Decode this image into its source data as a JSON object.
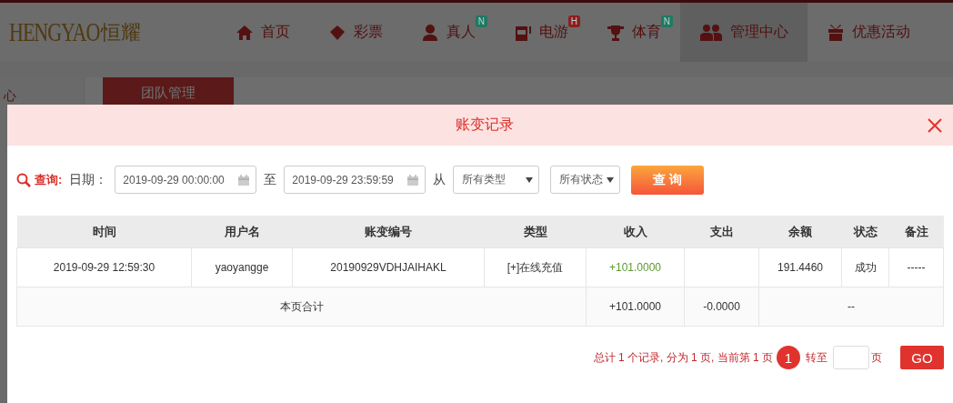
{
  "header": {
    "logo_latin": "HENGYAO",
    "logo_cjk": "恒耀",
    "nav": [
      {
        "label": "首页",
        "selected": false
      },
      {
        "label": "彩票",
        "selected": false
      },
      {
        "label": "真人",
        "badge": "N",
        "color": "#1c7a63",
        "selected": false
      },
      {
        "label": "电游",
        "badge": "H",
        "color": "#8c1e1e",
        "selected": false
      },
      {
        "label": "体育",
        "badge": "N",
        "color": "#1c7a63",
        "selected": false
      },
      {
        "label": "管理中心",
        "selected": true
      },
      {
        "label": "优惠活动",
        "selected": false
      }
    ]
  },
  "sidebar": {
    "items": [
      "心"
    ]
  },
  "tabs": [
    {
      "label": "团队管理",
      "selected": true
    }
  ],
  "modal": {
    "title": "账变记录",
    "filter": {
      "search_label": "查询:",
      "date_label": "日期：",
      "start": "2019-09-29 00:00:00",
      "to": "至",
      "end": "2019-09-29 23:59:59",
      "from": "从",
      "type_select": "所有类型",
      "status_select": "所有状态",
      "button": "查 询"
    },
    "table": {
      "columns": [
        "时间",
        "用户名",
        "账变编号",
        "类型",
        "收入",
        "支出",
        "余额",
        "状态",
        "备注"
      ],
      "rows": [
        [
          "2019-09-29 12:59:30",
          "yaoyangge",
          "20190929VDHJAIHAKL",
          "[+]在线充值",
          "+101.0000",
          "",
          "191.4460",
          "成功",
          "-----"
        ]
      ],
      "total": {
        "label": "本页合计",
        "income": "+101.0000",
        "expense": "-0.0000",
        "rest": "--"
      }
    },
    "pagination": {
      "summary": "总计 1 个记录, 分为 1 页, 当前第 1 页",
      "pages": [
        {
          "label": "1",
          "selected": true
        }
      ],
      "goto": "转至",
      "unit": "页",
      "go": "GO"
    }
  }
}
